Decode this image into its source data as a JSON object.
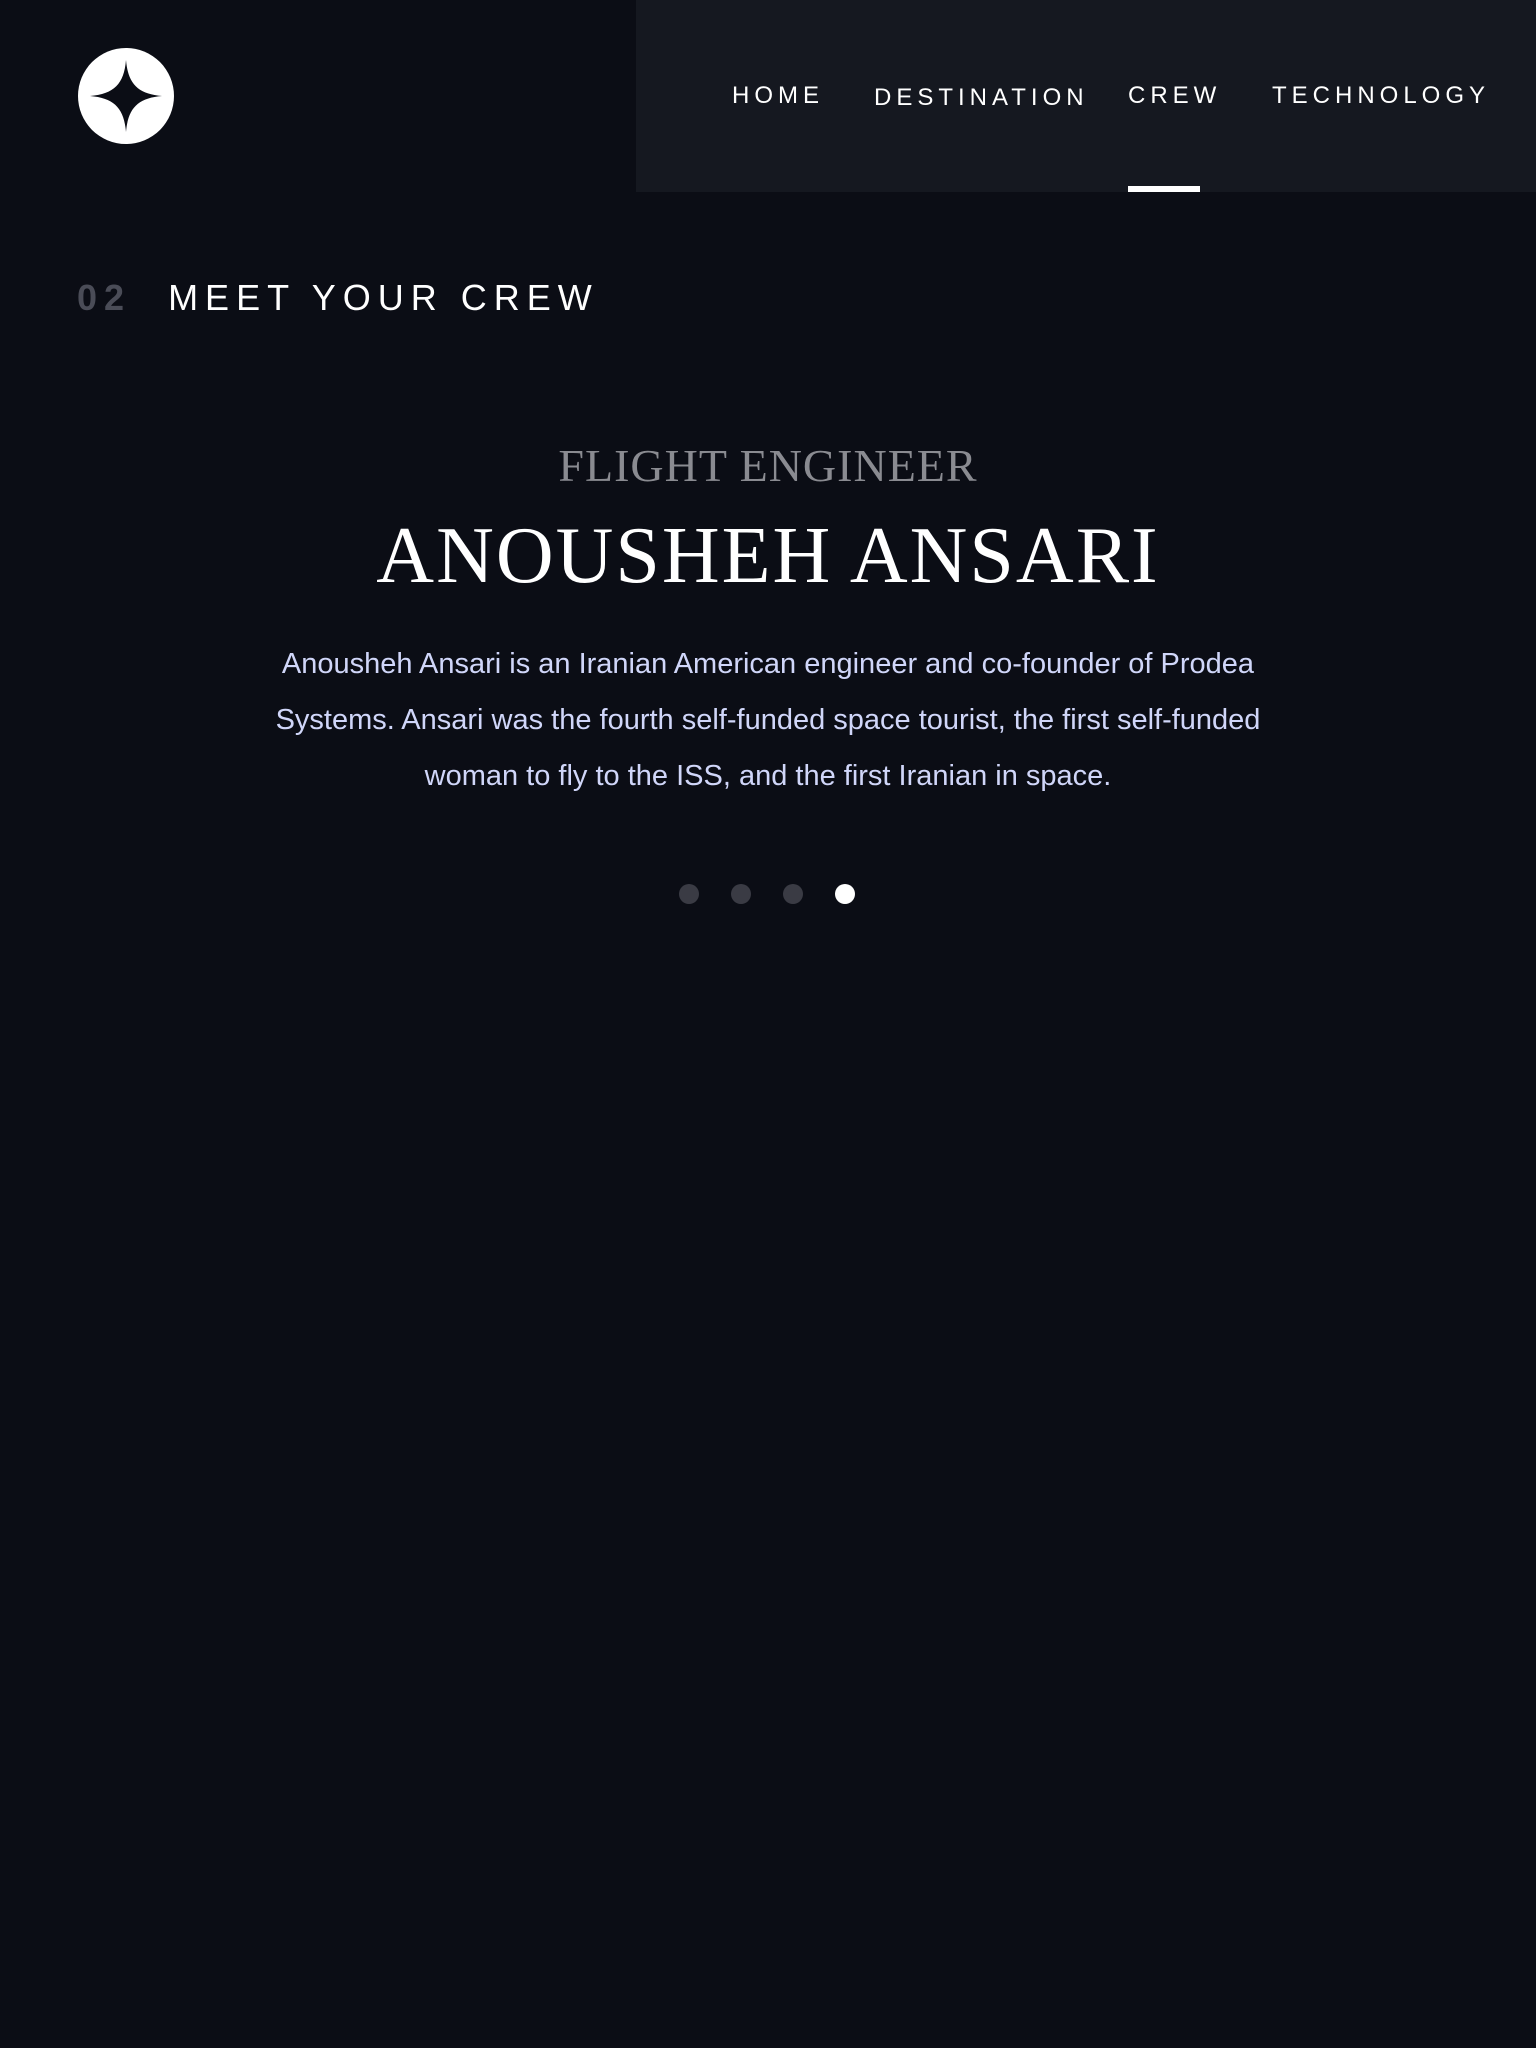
{
  "brand": {
    "logo_icon": "star-logo-icon"
  },
  "nav": {
    "items": [
      {
        "label": "HOME",
        "active": false
      },
      {
        "label": "DESTINATION",
        "active": false
      },
      {
        "label": "CREW",
        "active": true
      },
      {
        "label": "TECHNOLOGY",
        "active": false
      }
    ]
  },
  "section": {
    "number": "02",
    "title": "MEET YOUR CREW"
  },
  "crew": {
    "role": "FLIGHT ENGINEER",
    "name": "ANOUSHEH ANSARI",
    "bio": "Anousheh Ansari is an Iranian American engineer and co-founder of Prodea Systems. Ansari was the fourth self-funded space tourist, the first self-funded woman to fly to the ISS, and the first Iranian in space."
  },
  "carousel": {
    "count": 4,
    "active_index": 4
  },
  "colors": {
    "background": "#0b0d15",
    "nav_background": "#151820",
    "text": "#ffffff",
    "muted": "#8a8b91",
    "body_text": "#d0d6f9",
    "dot_inactive": "#3a3b44",
    "dot_active": "#ffffff"
  }
}
